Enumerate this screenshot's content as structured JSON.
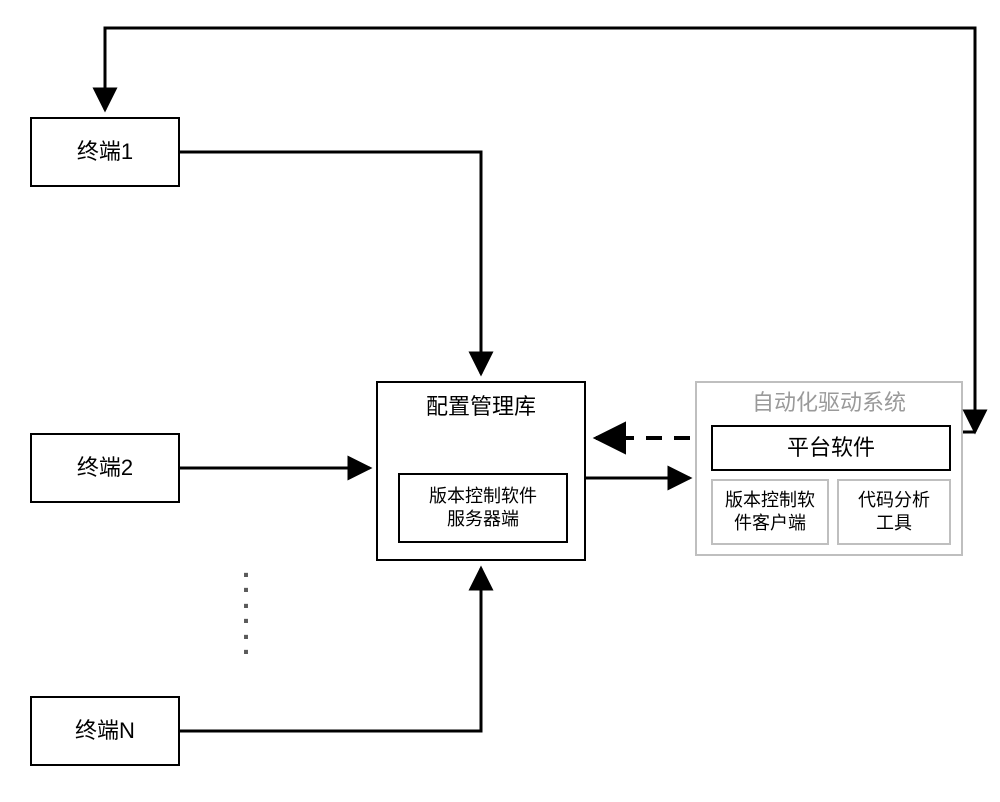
{
  "terminals": {
    "t1": "终端1",
    "t2": "终端2",
    "tn": "终端N"
  },
  "config_repo": {
    "title": "配置管理库",
    "server_box": "版本控制软件\n服务器端"
  },
  "auto_system": {
    "title": "自动化驱动系统",
    "platform": "平台软件",
    "vc_client": "版本控制软\n件客户端",
    "code_tool": "代码分析\n工具"
  }
}
